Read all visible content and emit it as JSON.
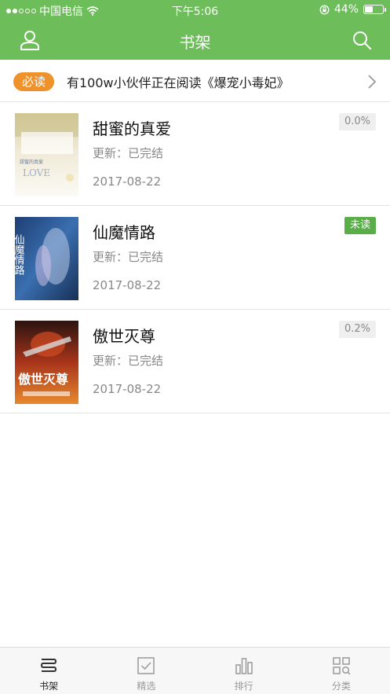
{
  "status_bar": {
    "carrier": "中国电信",
    "time": "下午5:06",
    "battery_text": "44%",
    "battery_level": 0.44,
    "signal_bars": 2,
    "signal_total": 5
  },
  "nav": {
    "title": "书架",
    "left_icon": "user-icon",
    "right_icon": "search-icon"
  },
  "notice": {
    "tag": "必读",
    "text": "有100w小伙伴正在阅读《爆宠小毒妃》"
  },
  "books": [
    {
      "title": "甜蜜的真爱",
      "update": "更新：已完结",
      "date": "2017-08-22",
      "badge": "0.0%",
      "badge_type": "progress",
      "cover_text": "LOVE",
      "cover_subtext": "甜蜜的真爱"
    },
    {
      "title": "仙魔情路",
      "update": "更新：已完结",
      "date": "2017-08-22",
      "badge": "未读",
      "badge_type": "unread",
      "cover_text": "仙魔情路"
    },
    {
      "title": "傲世灭尊",
      "update": "更新：已完结",
      "date": "2017-08-22",
      "badge": "0.2%",
      "badge_type": "progress",
      "cover_text": "傲世灭尊"
    }
  ],
  "tabs": [
    {
      "label": "书架",
      "icon": "bookshelf-icon",
      "active": true
    },
    {
      "label": "精选",
      "icon": "checkbox-icon",
      "active": false
    },
    {
      "label": "排行",
      "icon": "bar-chart-icon",
      "active": false
    },
    {
      "label": "分类",
      "icon": "grid-search-icon",
      "active": false
    }
  ],
  "colors": {
    "primary": "#6dbd5a",
    "notice_tag": "#f0922c",
    "unread_badge": "#5aae47"
  }
}
